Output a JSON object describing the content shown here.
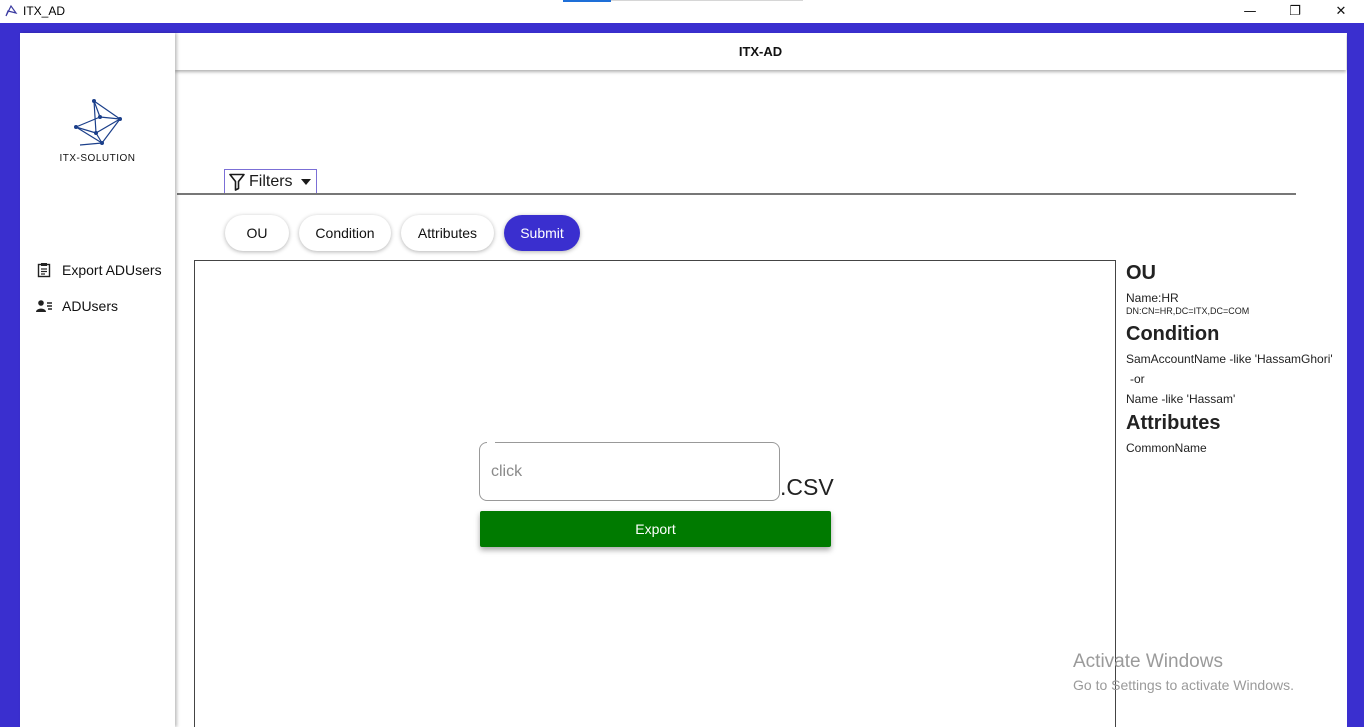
{
  "window": {
    "title": "ITX_AD",
    "icon": "app-logo-icon",
    "controls": {
      "minimize": "—",
      "maximize": "❐",
      "close": "✕"
    }
  },
  "colors": {
    "accent": "#3a2fcf",
    "export": "#007a00"
  },
  "sidebar": {
    "logo_text": "ITX-SOLUTION",
    "items": [
      {
        "label": "Export ADUsers",
        "icon": "list-icon"
      },
      {
        "label": "ADUsers",
        "icon": "users-icon"
      }
    ]
  },
  "header": {
    "title": "ITX-AD"
  },
  "filters": {
    "label": "Filters",
    "icon": "filter-icon"
  },
  "pills": {
    "ou": "OU",
    "condition": "Condition",
    "attributes": "Attributes",
    "submit": "Submit"
  },
  "export_form": {
    "placeholder": "click",
    "extension": ".CSV",
    "button": "Export"
  },
  "summary": {
    "ou_heading": "OU",
    "ou_name": "Name:HR",
    "ou_dn": "DN:CN=HR,DC=ITX,DC=COM",
    "condition_heading": "Condition",
    "condition_line1": "SamAccountName -like 'HassamGhori'",
    "condition_line2": "-or",
    "condition_line3": "Name -like 'Hassam'",
    "attributes_heading": "Attributes",
    "attributes_line1": "CommonName"
  },
  "watermark": {
    "title": "Activate Windows",
    "subtitle": "Go to Settings to activate Windows."
  }
}
